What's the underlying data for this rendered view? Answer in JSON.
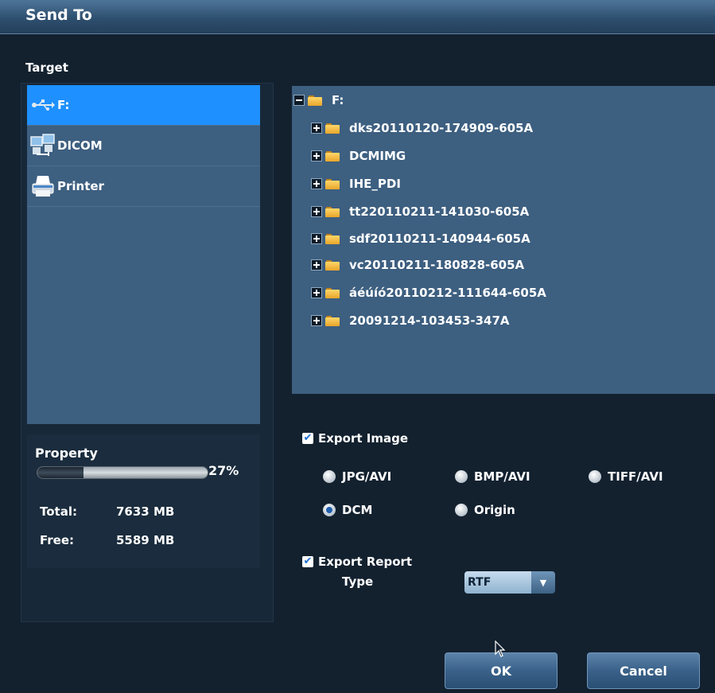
{
  "window": {
    "title": "Send To"
  },
  "target": {
    "label": "Target",
    "items": [
      {
        "label": "F:",
        "icon": "usb-icon",
        "selected": true
      },
      {
        "label": "DICOM",
        "icon": "network-computer-icon",
        "selected": false
      },
      {
        "label": "Printer",
        "icon": "printer-icon",
        "selected": false
      }
    ]
  },
  "property": {
    "label": "Property",
    "usage_percent": 27,
    "usage_text": "27%",
    "total_label": "Total:",
    "total_value": "7633 MB",
    "free_label": "Free:",
    "free_value": "5589 MB"
  },
  "tree": {
    "root": "F:",
    "children": [
      "dks20110120-174909-605A",
      "DCMIMG",
      "IHE_PDI",
      "tt220110211-141030-605A",
      "sdf20110211-140944-605A",
      "vc20110211-180828-605A",
      "áéúíó20110212-111644-605A",
      "20091214-103453-347A"
    ]
  },
  "export_image": {
    "label": "Export Image",
    "checked": true,
    "formats": [
      {
        "label": "JPG/AVI",
        "checked": false
      },
      {
        "label": "BMP/AVI",
        "checked": false
      },
      {
        "label": "TIFF/AVI",
        "checked": false
      },
      {
        "label": "DCM",
        "checked": true
      },
      {
        "label": "Origin",
        "checked": false
      }
    ]
  },
  "export_report": {
    "label": "Export Report",
    "checked": true,
    "type_label": "Type",
    "type_value": "RTF"
  },
  "buttons": {
    "ok": "OK",
    "cancel": "Cancel"
  },
  "colors": {
    "selected_row": "#1e90ff",
    "panel": "#3d5f80",
    "background": "#13212f"
  }
}
